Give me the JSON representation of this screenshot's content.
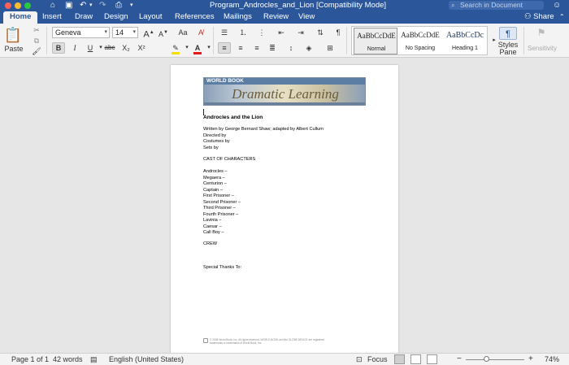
{
  "titlebar": {
    "doc_title": "Program_Androcles_and_Lion [Compatibility Mode]",
    "search_placeholder": "Search in Document",
    "icons": [
      "home-icon",
      "save-icon",
      "undo-icon",
      "redo-icon",
      "print-icon",
      "customize-icon",
      "search-icon",
      "feedback-smiley-icon"
    ]
  },
  "tabs": [
    "Home",
    "Insert",
    "Draw",
    "Design",
    "Layout",
    "References",
    "Mailings",
    "Review",
    "View"
  ],
  "active_tab": "Home",
  "share_label": "Share",
  "ribbon": {
    "paste_label": "Paste",
    "font_name": "Geneva",
    "font_size": "14",
    "bold": "B",
    "italic": "I",
    "underline": "U",
    "strikethrough": "abc",
    "subscript": "X₂",
    "superscript": "X²",
    "grow_font": "A",
    "shrink_font": "A",
    "styles": [
      {
        "preview": "AaBbCcDdE",
        "name": "Normal"
      },
      {
        "preview": "AaBbCcDdE",
        "name": "No Spacing"
      },
      {
        "preview": "AaBbCcDc",
        "name": "Heading 1"
      }
    ],
    "styles_pane_label": "Styles\nPane",
    "sensitivity_label": "Sensitivity",
    "highlight_color": "#f7e000",
    "font_color": "#e31b1b"
  },
  "document": {
    "banner_brand": "WORLD BOOK",
    "banner_title": "Dramatic Learning",
    "heading": "Androcles and the Lion",
    "credits": [
      "Written by George Bernard Shaw; adapted by Albert Cullum",
      "Directed by",
      "Costumes by",
      "Sets by"
    ],
    "cast_heading": "CAST OF CHARACTERS",
    "cast": [
      "Androcles –",
      "Megaera –",
      "Centurion –",
      "Captain –",
      "First Prisoner –",
      "Second Prisoner –",
      "Third Prisoner –",
      "Fourth Prisoner –",
      "Lavinia –",
      "Caesar –",
      "Call Boy –"
    ],
    "crew_heading": "CREW",
    "thanks": "Special Thanks To:",
    "legal": "© 2008 World Book, Inc. All rights reserved. WORLD BOOK and the GLOBE DEVICE are registered trademarks or trademarks of World Book, Inc."
  },
  "statusbar": {
    "page": "Page 1 of 1",
    "words": "42 words",
    "language": "English (United States)",
    "focus": "Focus",
    "zoom": "74%",
    "zoom_minus": "−",
    "zoom_plus": "+",
    "zoom_level": 0.74
  }
}
